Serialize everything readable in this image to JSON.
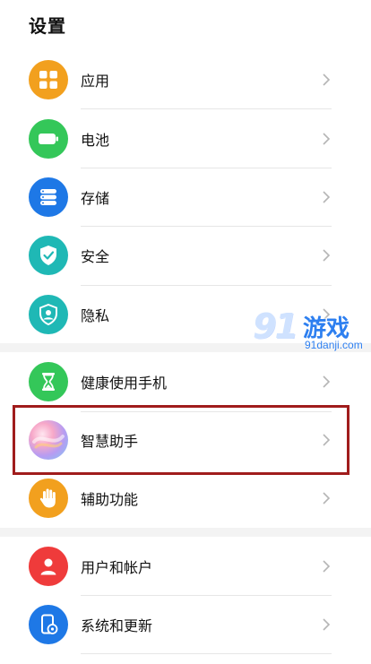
{
  "header": {
    "title": "设置"
  },
  "items": [
    {
      "label": "应用",
      "icon": "apps-grid-icon",
      "color": "#f2a01e"
    },
    {
      "label": "电池",
      "icon": "battery-icon",
      "color": "#34c759"
    },
    {
      "label": "存储",
      "icon": "storage-icon",
      "color": "#1e78e6"
    },
    {
      "label": "安全",
      "icon": "shield-check-icon",
      "color": "#1fb8b5"
    },
    {
      "label": "隐私",
      "icon": "privacy-shield-icon",
      "color": "#1fb8b5"
    },
    {
      "label": "健康使用手机",
      "icon": "hourglass-icon",
      "color": "#34c759"
    },
    {
      "label": "智慧助手",
      "icon": "assistant-orb-icon",
      "color": "#b7a6f0"
    },
    {
      "label": "辅助功能",
      "icon": "hand-icon",
      "color": "#f2a01e"
    },
    {
      "label": "用户和帐户",
      "icon": "user-icon",
      "color": "#ef3b3b"
    },
    {
      "label": "系统和更新",
      "icon": "system-update-icon",
      "color": "#1e78e6"
    }
  ],
  "watermark": {
    "logo": "91",
    "text": "游戏",
    "site": "91danji.com"
  }
}
